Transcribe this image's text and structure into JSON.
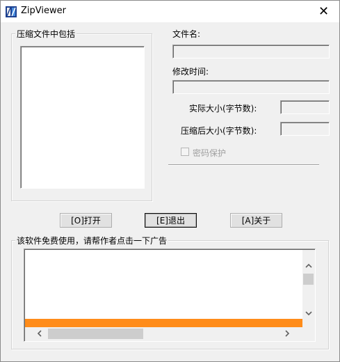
{
  "window": {
    "title": "ZipViewer"
  },
  "archive_group": {
    "label": "压缩文件中包括"
  },
  "details": {
    "filename_label": "文件名:",
    "filename_value": "",
    "modified_label": "修改时间:",
    "modified_value": "",
    "actual_size_label": "实际大小(字节数):",
    "actual_size_value": "",
    "compressed_size_label": "压缩后大小(字节数):",
    "compressed_size_value": "",
    "password_label": "密码保护"
  },
  "buttons": {
    "open": "[O]打开",
    "exit": "[E]退出",
    "about": "[A]关于"
  },
  "ad_group": {
    "label": "该软件免费使用，请帮作者点击一下广告",
    "banner_color": "#ff8c1a"
  },
  "icons": {
    "close": "close-icon",
    "app": "zip-app-icon"
  }
}
